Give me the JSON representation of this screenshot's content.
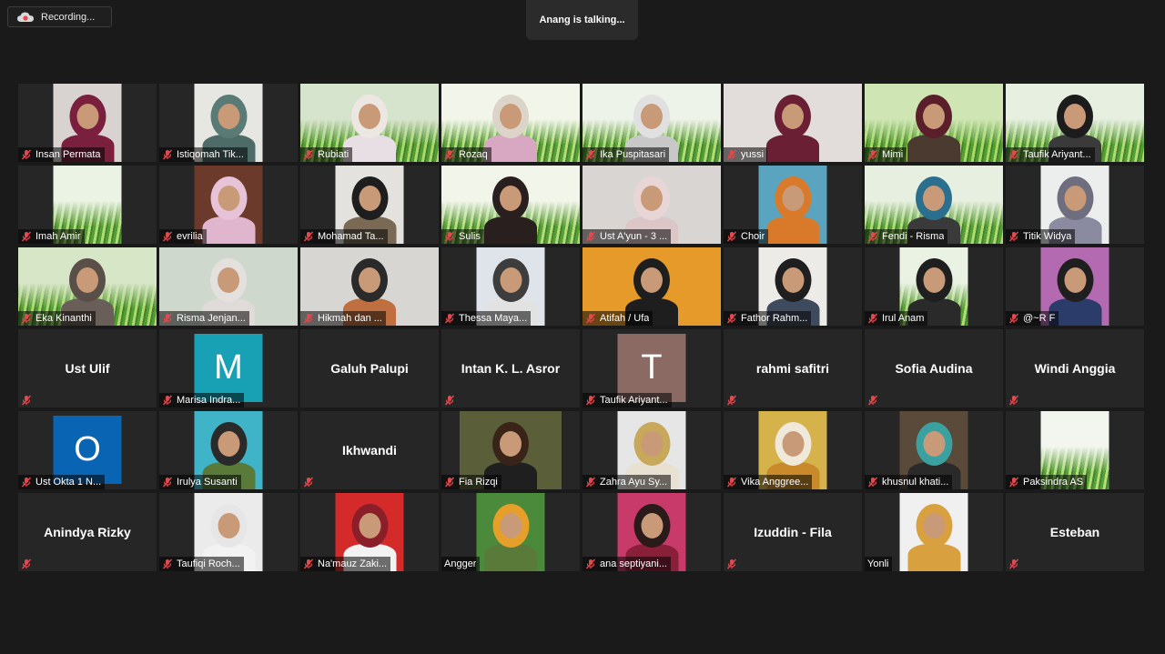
{
  "recording": {
    "label": "Recording..."
  },
  "speaker": {
    "text": "Anang is talking..."
  },
  "colors": {
    "muted": "#e5484d",
    "tile_bg": "#262626"
  },
  "participants": [
    {
      "name": "Insan Permata",
      "mode": "video",
      "muted": true,
      "bg": "#d8d3d0",
      "head": "#7a1f3d",
      "body": "#7a1f3d"
    },
    {
      "name": "Istiqomah Tik...",
      "mode": "video",
      "muted": true,
      "bg": "#e6e6e3",
      "head": "#5a7a75",
      "body": "#4d6c68"
    },
    {
      "name": "Rubiati",
      "mode": "video",
      "muted": true,
      "bg": "#d7e4cd",
      "grass": true,
      "head": "#ece7e2",
      "body": "#e8dfe4",
      "full": true
    },
    {
      "name": "Rozaq",
      "mode": "video",
      "muted": true,
      "bg": "#f2f6ea",
      "grass": true,
      "head": "#dcd4c8",
      "body": "#d8a8c2",
      "full": true
    },
    {
      "name": "Ika Puspitasari",
      "mode": "video",
      "muted": true,
      "bg": "#eef3ea",
      "grass": true,
      "head": "#e0e0e0",
      "body": "#c8c8c8",
      "full": true
    },
    {
      "name": "yussi",
      "mode": "video",
      "muted": true,
      "bg": "#e2dcda",
      "head": "#6a1f35",
      "body": "#6a1f35",
      "full": true
    },
    {
      "name": "Mimi",
      "mode": "video",
      "muted": true,
      "bg": "#cfe6b4",
      "grass": true,
      "head": "#5a1f2a",
      "body": "#4a3a30",
      "full": true
    },
    {
      "name": "Taufik Ariyant...",
      "mode": "video",
      "muted": true,
      "bg": "#e6efe0",
      "grass": true,
      "head": "#1c1c1c",
      "body": "#3a3a3a",
      "full": true
    },
    {
      "name": "Imah Amir",
      "mode": "video",
      "muted": true,
      "bg": "#eaf3e4",
      "grass": true,
      "head": "none",
      "body": "none"
    },
    {
      "name": "evrilia",
      "mode": "video",
      "muted": true,
      "bg": "#6b3a2a",
      "head": "#e6c3d6",
      "body": "#e0b6cf"
    },
    {
      "name": "Mohamad Ta...",
      "mode": "video",
      "muted": true,
      "bg": "#e3e2df",
      "head": "#1e1e1e",
      "body": "#7a6a55"
    },
    {
      "name": "Sulis",
      "mode": "video",
      "muted": true,
      "bg": "#f1f5ea",
      "grass": true,
      "head": "#2a1f1f",
      "body": "#2a1f1f",
      "full": true
    },
    {
      "name": "Ust A'yun - 3 ...",
      "mode": "video",
      "muted": true,
      "bg": "#d9d5d3",
      "head": "#e8d6d6",
      "body": "#dcc6c8",
      "full": true
    },
    {
      "name": "Choir",
      "mode": "video",
      "muted": true,
      "bg": "#5aa4bf",
      "head": "#d97a2a",
      "body": "#d97a2a"
    },
    {
      "name": "Fendi - Risma",
      "mode": "video",
      "muted": true,
      "bg": "#e6efe0",
      "grass": true,
      "head": "#2b6f8f",
      "body": "#3a3a3a",
      "full": true
    },
    {
      "name": "Titik Widya",
      "mode": "video",
      "muted": true,
      "bg": "#eceeee",
      "head": "#6e6e7e",
      "body": "#8a8aa0"
    },
    {
      "name": "Eka Kinanthi",
      "mode": "video",
      "muted": true,
      "bg": "#d8e6c8",
      "grass": true,
      "head": "#5a4f48",
      "body": "#6a5f58",
      "full": true
    },
    {
      "name": "Risma Jenjan...",
      "mode": "video",
      "muted": true,
      "bg": "#cfd8cc",
      "head": "#e4e0de",
      "body": "#e0dad8",
      "full": true
    },
    {
      "name": "Hikmah dan ...",
      "mode": "video",
      "muted": true,
      "bg": "#d8d6d2",
      "head": "#2a2a2a",
      "body": "#c07040",
      "full": true
    },
    {
      "name": "Thessa Maya...",
      "mode": "video",
      "muted": true,
      "bg": "#dfe4ea",
      "head": "#3d3d3d",
      "body": "#e2e2e2"
    },
    {
      "name": "Atifah / Ufa",
      "mode": "video",
      "muted": true,
      "bg": "#e69a2a",
      "head": "#1e1e1e",
      "body": "#1e1e1e",
      "full": true
    },
    {
      "name": "Fathor Rahm...",
      "mode": "video",
      "muted": true,
      "bg": "#ecebe8",
      "head": "#1f1f1f",
      "body": "#3e4a5e"
    },
    {
      "name": "Irul Anam",
      "mode": "video",
      "muted": true,
      "bg": "#eaf2e4",
      "grass": true,
      "head": "#1f1f1f",
      "body": "#2a2a2a"
    },
    {
      "name": "@~R F",
      "mode": "video",
      "muted": true,
      "bg": "#b46ab0",
      "head": "#1f1f1f",
      "body": "#2c3c6a"
    },
    {
      "name": "Ust Ulif",
      "mode": "name",
      "muted": true
    },
    {
      "name": "Marisa Indra...",
      "mode": "avatar",
      "muted": true,
      "letter": "M",
      "avatar_color": "#18a0b4"
    },
    {
      "name": "Galuh Palupi",
      "mode": "name",
      "muted": false
    },
    {
      "name": "Intan K. L. Asror",
      "mode": "name",
      "muted": true
    },
    {
      "name": "Taufik Ariyant...",
      "mode": "avatar",
      "muted": true,
      "letter": "T",
      "avatar_color": "#8a6a62"
    },
    {
      "name": "rahmi safitri",
      "mode": "name",
      "muted": true
    },
    {
      "name": "Sofia Audina",
      "mode": "name",
      "muted": true
    },
    {
      "name": "Windi Anggia",
      "mode": "name",
      "muted": true
    },
    {
      "name": "Ust Okta 1 N...",
      "mode": "avatar",
      "muted": true,
      "letter": "O",
      "avatar_color": "#0a64b4"
    },
    {
      "name": "Irulya Susanti",
      "mode": "video",
      "muted": true,
      "bg": "#3fb4c8",
      "head": "#2a2a2a",
      "body": "#5a7a3a"
    },
    {
      "name": "Ikhwandi",
      "mode": "name",
      "muted": true
    },
    {
      "name": "Fia Rizqi",
      "mode": "video",
      "muted": true,
      "bg": "#5a5f3a",
      "head": "#3a2418",
      "body": "#1f1f1f",
      "wide": true
    },
    {
      "name": "Zahra Ayu Sy...",
      "mode": "video",
      "muted": true,
      "bg": "#e6e6e6",
      "head": "#c8a85a",
      "body": "#e8e0d0"
    },
    {
      "name": "Vika Anggree...",
      "mode": "video",
      "muted": true,
      "bg": "#d6b24a",
      "head": "#f0e8d8",
      "body": "#c88a2a"
    },
    {
      "name": "khusnul khati...",
      "mode": "video",
      "muted": true,
      "bg": "#5a4a3a",
      "head": "#3aa0a0",
      "body": "#2a2a2a"
    },
    {
      "name": "Paksindra AS",
      "mode": "video",
      "muted": true,
      "bg": "#f2f6ee",
      "grass": true,
      "head": "none",
      "body": "none"
    },
    {
      "name": "Anindya Rizky",
      "mode": "name",
      "muted": true
    },
    {
      "name": "Taufiqi Roch...",
      "mode": "video",
      "muted": true,
      "bg": "#ebebeb",
      "head": "#e6e6e6",
      "body": "#f2f2f2"
    },
    {
      "name": "Na'mauz Zaki...",
      "mode": "video",
      "muted": true,
      "bg": "#d42a2a",
      "head": "#8a1f2a",
      "body": "#f2f2f2"
    },
    {
      "name": "Angger",
      "mode": "video",
      "muted": false,
      "bg": "#4a8a3a",
      "head": "#e6a02a",
      "body": "#5a7a3a"
    },
    {
      "name": "ana septiyani...",
      "mode": "video",
      "muted": true,
      "bg": "#c83a6a",
      "head": "#2a1a1a",
      "body": "#8a1f3a"
    },
    {
      "name": "Izuddin - Fila",
      "mode": "name",
      "muted": true
    },
    {
      "name": "Yonli",
      "mode": "video",
      "muted": false,
      "bg": "#f0f0f0",
      "head": "#d9a040",
      "body": "#d9a040"
    },
    {
      "name": "Esteban",
      "mode": "name",
      "muted": true
    }
  ]
}
